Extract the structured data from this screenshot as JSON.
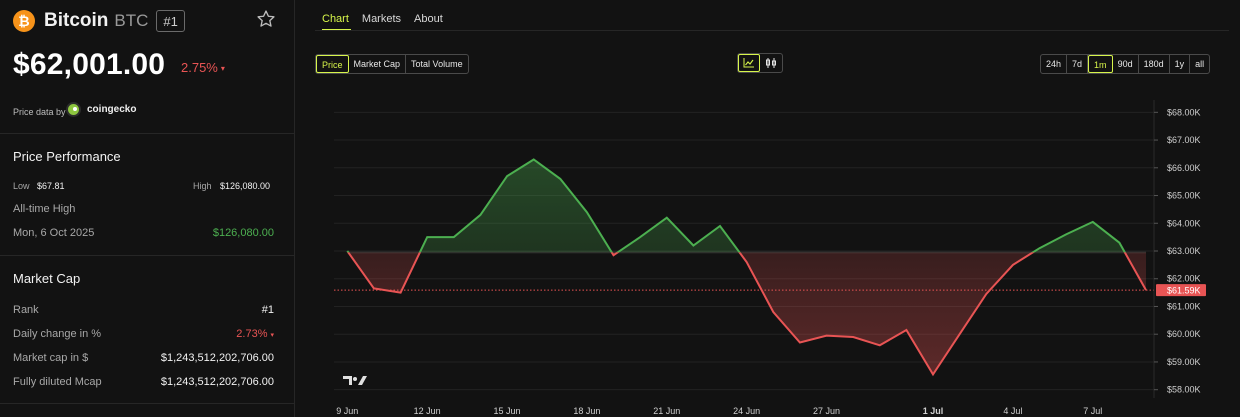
{
  "coin": {
    "logo_char": "₿",
    "name": "Bitcoin",
    "symbol": "BTC",
    "rank": "#1",
    "price": "$62,001.00",
    "price_change": "2.75%",
    "price_change_arrow": "▾"
  },
  "price_data": {
    "label": "Price data by",
    "provider": "coingecko"
  },
  "performance": {
    "title": "Price Performance",
    "low_label": "Low",
    "low_value": "$67.81",
    "high_label": "High",
    "high_value": "$126,080.00",
    "ath_label": "All-time High",
    "ath_date": "Mon, 6 Oct 2025",
    "ath_value": "$126,080.00"
  },
  "market_cap": {
    "title": "Market Cap",
    "rows": [
      {
        "label": "Rank",
        "value": "#1"
      },
      {
        "label": "Daily change in %",
        "value": "2.73%",
        "arrow": "▾"
      },
      {
        "label": "Market cap in $",
        "value": "$1,243,512,202,706.00"
      },
      {
        "label": "Fully diluted Mcap",
        "value": "$1,243,512,202,706.00"
      }
    ]
  },
  "tabs": [
    "Chart",
    "Markets",
    "About"
  ],
  "metric_buttons": [
    "Price",
    "Market Cap",
    "Total Volume"
  ],
  "chart_type_icons": [
    "line-chart-icon",
    "candlestick-icon"
  ],
  "range_buttons": [
    "24h",
    "7d",
    "1m",
    "90d",
    "180d",
    "1y",
    "all"
  ],
  "active_range": "1m",
  "colors": {
    "accent": "#d7f54a",
    "up": "#4caf50",
    "down": "#e85454",
    "btc": "#f7931a"
  },
  "chart_data": {
    "type": "area",
    "baseline": 62950,
    "current_price_label": "$61.59K",
    "current_price": 61590,
    "ylim": [
      57700,
      68300
    ],
    "y_ticks": [
      58000,
      59000,
      60000,
      61000,
      62000,
      63000,
      64000,
      65000,
      66000,
      67000,
      68000
    ],
    "y_tick_labels": [
      "$58.00K",
      "$59.00K",
      "$60.00K",
      "$61.00K",
      "$62.00K",
      "$63.00K",
      "$64.00K",
      "$65.00K",
      "$66.00K",
      "$67.00K",
      "$68.00K"
    ],
    "x_range": [
      1,
      37
    ],
    "x_ticks": [
      9,
      12,
      15,
      18,
      21,
      24,
      27,
      31,
      34,
      37
    ],
    "x_tick_labels": [
      "9 Jun",
      "12 Jun",
      "15 Jun",
      "18 Jun",
      "21 Jun",
      "24 Jun",
      "27 Jun",
      "1 Jul",
      "4 Jul",
      "7 Jul"
    ],
    "x_tick_bold": [
      false,
      false,
      false,
      false,
      false,
      false,
      false,
      true,
      false,
      false
    ],
    "x": [
      9,
      10,
      11,
      12,
      13,
      14,
      15,
      16,
      17,
      18,
      19,
      20,
      21,
      22,
      23,
      24,
      25,
      26,
      27,
      28,
      29,
      30,
      31,
      32,
      33,
      34,
      35,
      36,
      37,
      38,
      39
    ],
    "y": [
      63000,
      61650,
      61500,
      63500,
      63500,
      64300,
      65700,
      66300,
      65600,
      64400,
      62850,
      63500,
      64200,
      63200,
      63900,
      62600,
      60800,
      59700,
      59950,
      59900,
      59600,
      60150,
      58550,
      60000,
      61450,
      62500,
      63100,
      63600,
      64050,
      63300,
      61590
    ]
  }
}
